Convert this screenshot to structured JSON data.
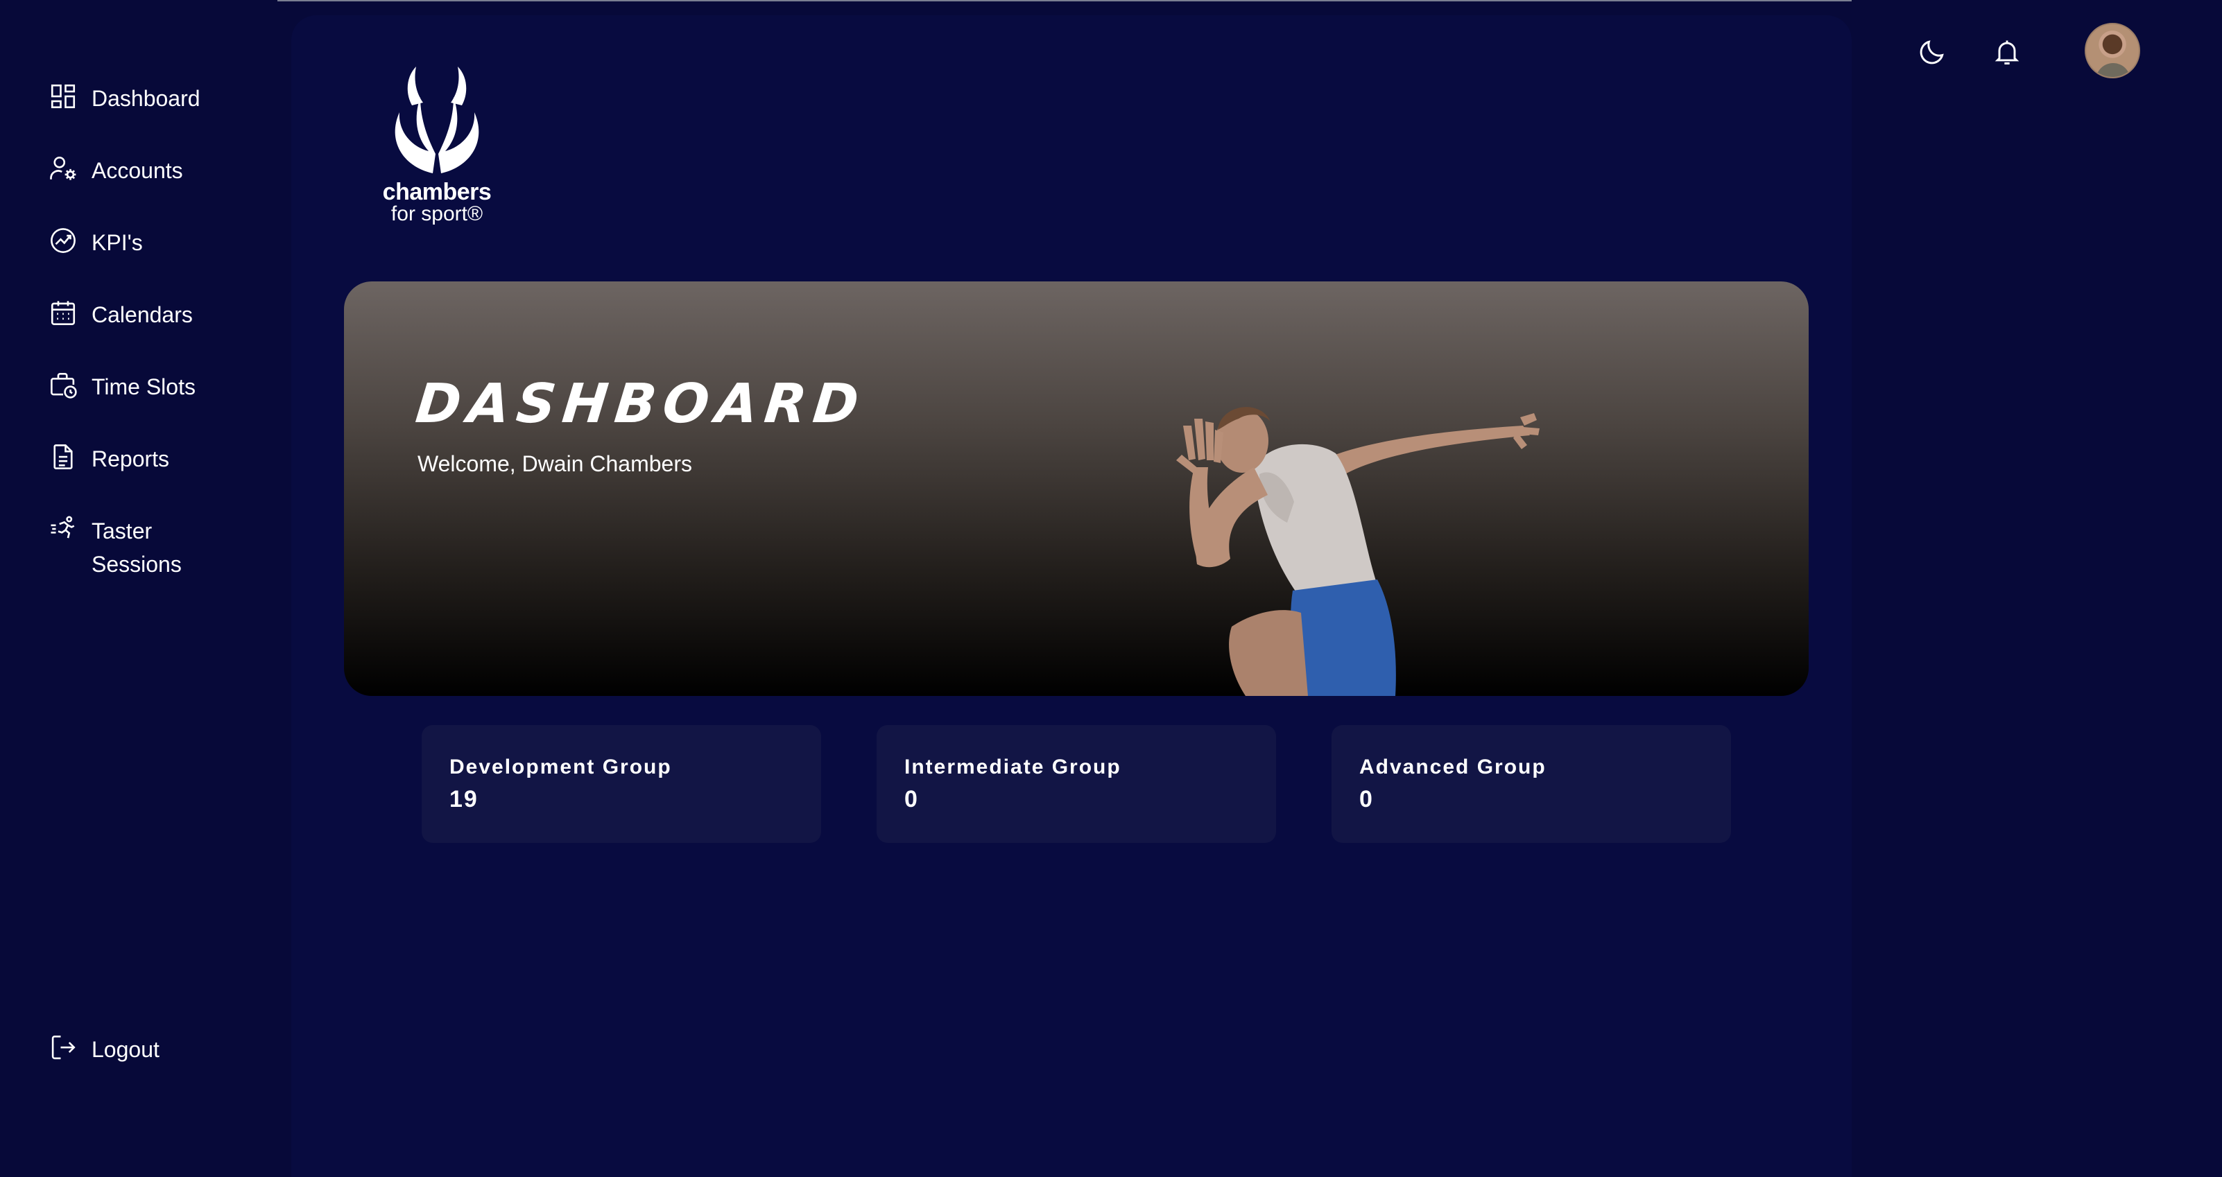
{
  "brand": {
    "name_line1": "chambers",
    "name_line2": "for sport®"
  },
  "sidebar": {
    "items": [
      {
        "label": "Dashboard",
        "icon": "dashboard-grid-icon"
      },
      {
        "label": "Accounts",
        "icon": "user-settings-icon"
      },
      {
        "label": "KPI's",
        "icon": "trend-chart-icon"
      },
      {
        "label": "Calendars",
        "icon": "calendar-icon"
      },
      {
        "label": "Time Slots",
        "icon": "briefcase-clock-icon"
      },
      {
        "label": "Reports",
        "icon": "document-icon"
      },
      {
        "label": "Taster Sessions",
        "icon": "running-person-icon"
      }
    ],
    "logout_label": "Logout"
  },
  "header": {
    "theme_icon": "moon-icon",
    "notifications_icon": "bell-icon",
    "avatar_icon": "user-avatar"
  },
  "banner": {
    "title": "DASHBOARD",
    "welcome": "Welcome, Dwain Chambers"
  },
  "stats": [
    {
      "label": "Development Group",
      "value": "19"
    },
    {
      "label": "Intermediate Group",
      "value": "0"
    },
    {
      "label": "Advanced Group",
      "value": "0"
    }
  ],
  "colors": {
    "background": "#070939",
    "main_panel": "#080b40",
    "card": "#121545",
    "text": "#ffffff"
  }
}
